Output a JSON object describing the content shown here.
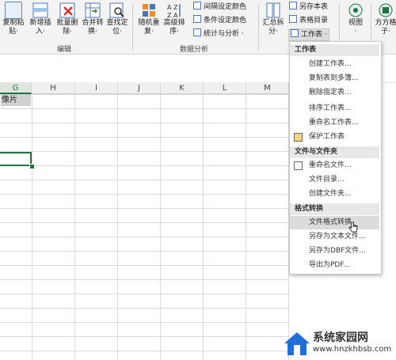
{
  "ribbon": {
    "buttons": [
      {
        "l1": "复制粘",
        "l2": "贴·",
        "icon": "copy-paste-icon"
      },
      {
        "l1": "新增插",
        "l2": "入·",
        "icon": "insert-icon"
      },
      {
        "l1": "批量删",
        "l2": "除·",
        "icon": "batch-delete-icon"
      },
      {
        "l1": "合并转",
        "l2": "换·",
        "icon": "merge-convert-icon"
      },
      {
        "l1": "查找定",
        "l2": "位·",
        "icon": "find-locate-icon"
      },
      {
        "l1": "随机重",
        "l2": "复·",
        "icon": "random-repeat-icon"
      },
      {
        "l1": "高级排",
        "l2": "序·",
        "icon": "advanced-sort-icon"
      },
      {
        "l1": "汇总拆",
        "l2": "分·",
        "icon": "summary-split-icon"
      },
      {
        "l1": "视图",
        "l2": "·",
        "icon": "view-icon"
      },
      {
        "l1": "方方格",
        "l2": "子·",
        "icon": "fangfang-gezi-icon"
      }
    ],
    "small_items": [
      {
        "label": "间隔设定颜色",
        "icon": "interval-color-icon"
      },
      {
        "label": "条件设定颜色",
        "icon": "condition-color-icon"
      },
      {
        "label": "统计与分析 ·",
        "icon": "statistics-icon"
      },
      {
        "label": "另存本表",
        "icon": "save-sheet-icon"
      },
      {
        "label": "表格目录",
        "icon": "sheet-directory-icon"
      },
      {
        "label": "工作表 ·",
        "icon": "worksheet-icon"
      }
    ],
    "groups": [
      "编辑",
      "数据分析"
    ]
  },
  "sheet": {
    "columns": [
      "G",
      "H",
      "I",
      "J",
      "K",
      "L",
      "M"
    ],
    "cell_g1": "像片"
  },
  "menu": {
    "sections": [
      {
        "header": "工作表",
        "items": [
          "创建工作表...",
          "复制表到多簿...",
          "删除指定表...",
          "排序工作表...",
          "重命名工作表...",
          "保护工作表"
        ]
      },
      {
        "header": "文件与文件夹",
        "items": [
          "重命名文件...",
          "文件目录...",
          "创建文件夹..."
        ]
      },
      {
        "header": "格式转换",
        "items": [
          "文件格式转换",
          "另存为文本文件...",
          "另存为DBF文件...",
          "导出为PDF..."
        ]
      }
    ],
    "highlighted": "文件格式转换"
  },
  "watermark": {
    "title": "系统家园网",
    "url": "www.hnzkhbsb.com"
  },
  "colors": {
    "accent": "#217346",
    "menu_highlight": "#dcdcdc"
  }
}
